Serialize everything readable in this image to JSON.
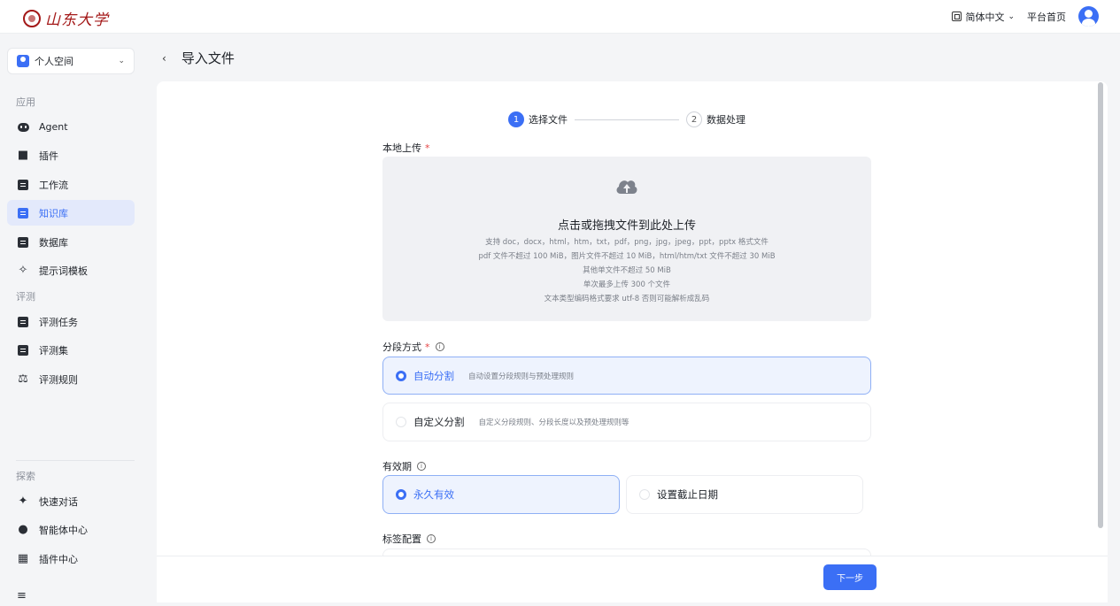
{
  "header": {
    "logo_text": "山东大学",
    "language": "简体中文",
    "home_link": "平台首页"
  },
  "sidebar": {
    "space": "个人空间",
    "sections": [
      {
        "title": "应用",
        "items": [
          "Agent",
          "插件",
          "工作流",
          "知识库",
          "数据库",
          "提示词模板"
        ]
      },
      {
        "title": "评测",
        "items": [
          "评测任务",
          "评测集",
          "评测规则"
        ]
      },
      {
        "title": "探索",
        "items": [
          "快速对话",
          "智能体中心",
          "插件中心"
        ]
      }
    ],
    "active_item": "知识库"
  },
  "main": {
    "title": "导入文件",
    "steps": [
      {
        "num": "1",
        "label": "选择文件"
      },
      {
        "num": "2",
        "label": "数据处理"
      }
    ],
    "upload": {
      "label": "本地上传",
      "required_mark": "*",
      "title": "点击或拖拽文件到此处上传",
      "line1": "支持 doc，docx，html，htm，txt，pdf，png，jpg，jpeg，ppt，pptx 格式文件",
      "line2": "pdf 文件不超过 100 MiB，图片文件不超过 10 MiB，html/htm/txt 文件不超过 30 MiB",
      "line3": "其他单文件不超过 50 MiB",
      "line4": "单次最多上传 300 个文件",
      "line5": "文本类型编码格式要求 utf-8 否则可能解析成乱码"
    },
    "segment": {
      "label": "分段方式",
      "info": "i",
      "options": [
        {
          "title": "自动分割",
          "desc": "自动设置分段规则与预处理规则",
          "selected": true
        },
        {
          "title": "自定义分割",
          "desc": "自定义分段规则、分段长度以及预处理规则等",
          "selected": false
        }
      ]
    },
    "validity": {
      "label": "有效期",
      "info": "i",
      "options": [
        {
          "title": "永久有效",
          "selected": true
        },
        {
          "title": "设置截止日期",
          "selected": false
        }
      ]
    },
    "tags": {
      "label": "标签配置",
      "info": "i"
    },
    "next_button": "下一步"
  },
  "colors": {
    "accent": "#3b6ff5",
    "brand_red": "#a31818",
    "required": "#e54545"
  }
}
